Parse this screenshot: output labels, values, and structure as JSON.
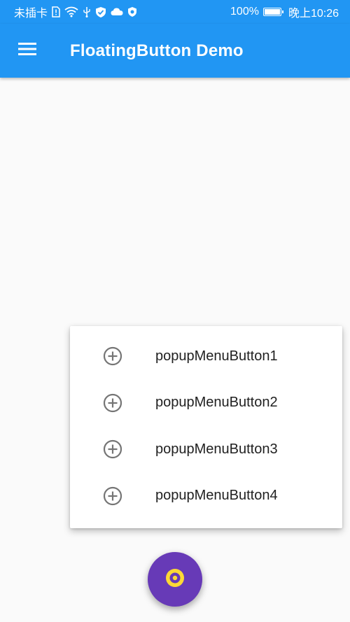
{
  "status_bar": {
    "carrier": "未插卡",
    "battery": "100%",
    "battery_level": 1.0,
    "time": "晚上10:26",
    "icons": [
      "sim-alert-icon",
      "wifi-icon",
      "usb-icon",
      "shield-check-icon",
      "cloud-icon",
      "security-badge-icon",
      "battery-icon"
    ]
  },
  "app_bar": {
    "title": "FloatingButton Demo",
    "menu_icon": "hamburger-menu-icon",
    "background": "#2196f3"
  },
  "popup_menu": {
    "items": [
      {
        "label": "popupMenuButton1",
        "icon": "add-circle-icon"
      },
      {
        "label": "popupMenuButton2",
        "icon": "add-circle-icon"
      },
      {
        "label": "popupMenuButton3",
        "icon": "add-circle-icon"
      },
      {
        "label": "popupMenuButton4",
        "icon": "add-circle-icon"
      }
    ]
  },
  "fab": {
    "icon": "disc-icon",
    "background": "#673ab7",
    "icon_color": "#fdd835"
  }
}
